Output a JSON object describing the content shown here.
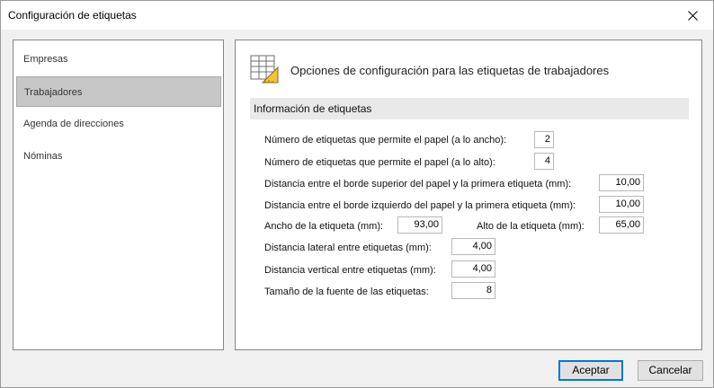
{
  "window": {
    "title": "Configuración de etiquetas"
  },
  "sidebar": {
    "items": [
      {
        "label": "Empresas"
      },
      {
        "label": "Trabajadores",
        "selected": true
      },
      {
        "label": "Agenda de direcciones"
      },
      {
        "label": "Nóminas"
      }
    ]
  },
  "panel": {
    "header_icon": "label-sheet-icon",
    "title": "Opciones de configuración para las etiquetas de trabajadores",
    "section_title": "Información de etiquetas",
    "fields": {
      "per_width": {
        "label": "Número de etiquetas que permite el papel (a lo ancho):",
        "value": "2"
      },
      "per_height": {
        "label": "Número de etiquetas que permite el papel (a lo alto):",
        "value": "4"
      },
      "top_margin": {
        "label": "Distancia entre el borde superior del papel y la primera etiqueta (mm):",
        "value": "10,00"
      },
      "left_margin": {
        "label": "Distancia entre el borde izquierdo del papel y la primera etiqueta (mm):",
        "value": "10,00"
      },
      "label_width": {
        "label": "Ancho de la etiqueta (mm):",
        "value": "93,00"
      },
      "label_height": {
        "label": "Alto de la etiqueta (mm):",
        "value": "65,00"
      },
      "lateral_gap": {
        "label": "Distancia lateral entre etiquetas (mm):",
        "value": "4,00"
      },
      "vertical_gap": {
        "label": "Distancia vertical entre etiquetas (mm):",
        "value": "4,00"
      },
      "font_size": {
        "label": "Tamaño de la fuente de las etiquetas:",
        "value": "8"
      }
    }
  },
  "buttons": {
    "accept": "Aceptar",
    "cancel": "Cancelar"
  },
  "colors": {
    "accent": "#0078d7",
    "selected_item": "#c7c7c7",
    "section_bar": "#e9e9e9"
  }
}
